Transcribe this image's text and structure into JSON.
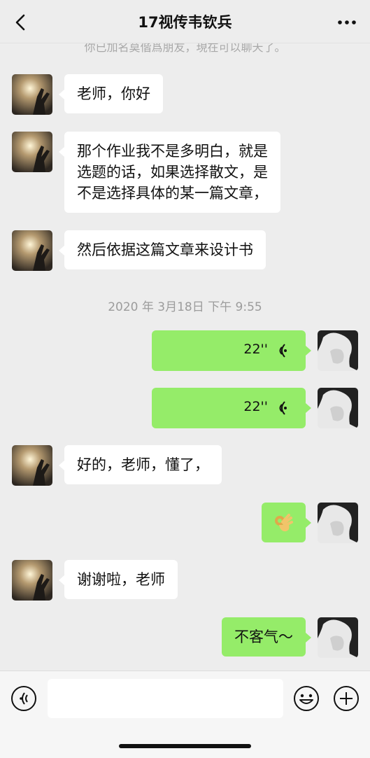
{
  "header": {
    "title": "17视传韦钦兵",
    "back_icon": "chevron-left-icon",
    "more_icon": "more-dots-icon"
  },
  "chat": {
    "system_note": "你已加名莫偕爲朋友，現在可以聊天了。",
    "timestamp": "2020 年 3月18日 下午 9:55",
    "incoming": [
      {
        "text": "老师，你好"
      },
      {
        "text": "那个作业我不是多明白，就是\n选题的话，如果选择散文，是\n不是选择具体的某一篇文章，"
      },
      {
        "text": "然后依据这篇文章来设计书"
      },
      {
        "text": "好的，老师，懂了，"
      },
      {
        "text": "谢谢啦，老师"
      }
    ],
    "outgoing_voice": [
      {
        "duration": "22''"
      },
      {
        "duration": "22''"
      }
    ],
    "outgoing_emoji": {
      "icon": "ok-hand-emoji"
    },
    "outgoing_text": {
      "text": "不客气～"
    }
  },
  "input_bar": {
    "voice_icon": "voice-mode-icon",
    "input_value": "",
    "emoji_icon": "smiley-icon",
    "plus_icon": "plus-circle-icon"
  },
  "colors": {
    "background": "#ededed",
    "incoming_bubble": "#ffffff",
    "outgoing_bubble": "#95ec69"
  }
}
